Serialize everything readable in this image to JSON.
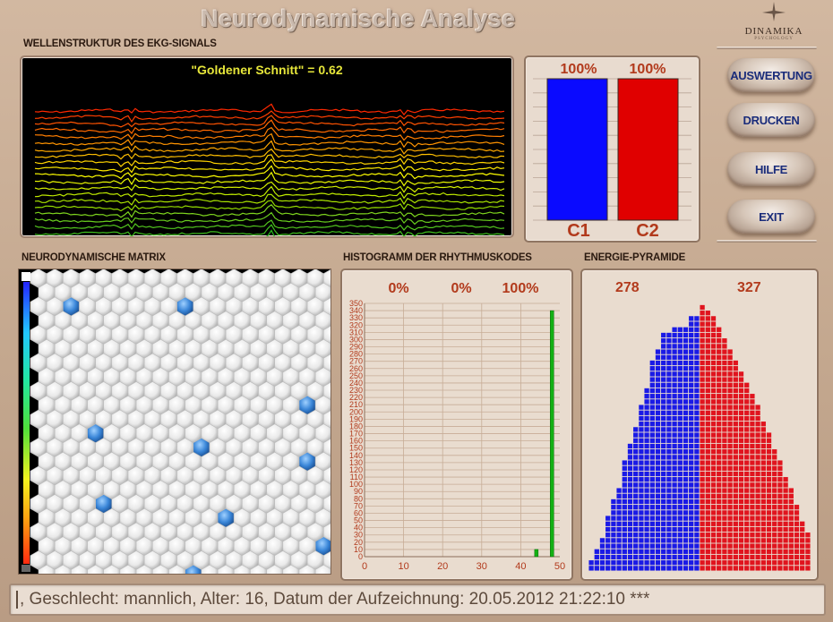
{
  "app": {
    "title": "Neurodynamische Analyse"
  },
  "logo": {
    "text": "DINAMIKA",
    "sub": "PSYCHOLOGY"
  },
  "sections": {
    "ekg": "WELLENSTRUKTUR DES EKG-SIGNALS",
    "matrix": "NEURODYNAMISCHE MATRIX",
    "histogram": "HISTOGRAMM DER RHYTHMUSKODES",
    "pyramid": "ENERGIE-PYRAMIDE"
  },
  "ekg": {
    "golden_label": "\"Goldener Schnitt\" = 0.62"
  },
  "buttons": {
    "auswertung": "AUSWERTUNG",
    "drucken": "DRUCKEN",
    "hilfe": "HILFE",
    "exit": "EXIT"
  },
  "cbars": {
    "c1": {
      "label": "C1",
      "percent_label": "100%",
      "value": 1.0,
      "color": "#0a0aff"
    },
    "c2": {
      "label": "C2",
      "percent_label": "100%",
      "value": 1.0,
      "color": "#e00000"
    }
  },
  "histogram": {
    "percent_labels": [
      "0%",
      "0%",
      "100%"
    ],
    "y_ticks": [
      0,
      10,
      20,
      30,
      40,
      50,
      60,
      70,
      80,
      90,
      100,
      110,
      120,
      130,
      140,
      150,
      160,
      170,
      180,
      190,
      200,
      210,
      220,
      230,
      240,
      250,
      260,
      270,
      280,
      290,
      300,
      310,
      320,
      330,
      340,
      350
    ],
    "x_ticks": [
      0,
      10,
      20,
      30,
      40,
      50
    ],
    "xlim": [
      0,
      50
    ],
    "ylim": [
      0,
      350
    ],
    "bars": [
      {
        "x": 44,
        "value": 10,
        "color": "#13b013"
      },
      {
        "x": 48,
        "value": 340,
        "color": "#13b013"
      }
    ]
  },
  "pyramid": {
    "left_value": "278",
    "right_value": "327",
    "left_color": "#1a1ae6",
    "right_color": "#e0141e"
  },
  "matrix": {
    "highlight_color": "#2f7fd6"
  },
  "status": {
    "text": ", Geschlecht: mannlich, Alter: 16, Datum der Aufzeichnung: 20.05.2012 21:22:10   ***"
  }
}
